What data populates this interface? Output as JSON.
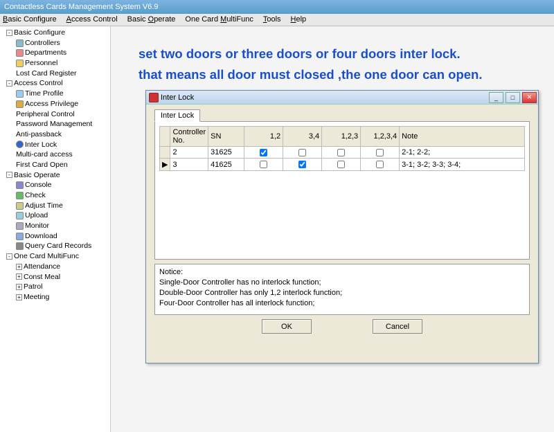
{
  "app_title": "Contactless Cards Management System  V6.9",
  "menu": [
    "Basic Configure",
    "Access Control",
    "Basic Operate",
    "One Card MultiFunc",
    "Tools",
    "Help"
  ],
  "tree": {
    "basic_configure": "Basic Configure",
    "controllers": "Controllers",
    "departments": "Departments",
    "personnel": "Personnel",
    "lost_card": "Lost Card Register",
    "access_control": "Access Control",
    "time_profile": "Time Profile",
    "access_priv": "Access Privilege",
    "periph": "Peripheral Control",
    "password": "Password Management",
    "antipass": "Anti-passback",
    "inter_lock": "Inter Lock",
    "multicard": "Multi-card access",
    "first_card": "First Card Open",
    "basic_operate": "Basic Operate",
    "console": "Console",
    "check": "Check",
    "adjust": "Adjust Time",
    "upload": "Upload",
    "monitor": "Monitor",
    "download": "Download",
    "query": "Query Card Records",
    "multifunc": "One Card MultiFunc",
    "attendance": "Attendance",
    "const_meal": "Const Meal",
    "patrol": "Patrol",
    "meeting": "Meeting"
  },
  "annotation": {
    "line1": "set two doors or three doors or four doors inter lock.",
    "line2": "that means all door must closed ,the one door can open."
  },
  "dialog": {
    "title": "Inter Lock",
    "tab": "Inter Lock",
    "headers": {
      "ctrl": "Controller No.",
      "sn": "SN",
      "c12": "1,2",
      "c34": "3,4",
      "c123": "1,2,3",
      "c1234": "1,2,3,4",
      "note": "Note"
    },
    "rows": [
      {
        "ctrl": "2",
        "sn": "31625",
        "c12": true,
        "c34": false,
        "c123": false,
        "c1234": false,
        "note": "2-1;  2-2;"
      },
      {
        "ctrl": "3",
        "sn": "41625",
        "c12": false,
        "c34": true,
        "c123": false,
        "c1234": false,
        "note": "3-1;  3-2;  3-3;  3-4;"
      }
    ],
    "notice": {
      "title": "Notice:",
      "l1": "Single-Door Controller has no interlock function;",
      "l2": "Double-Door Controller has only 1,2 interlock function;",
      "l3": "Four-Door Controller has all interlock function;"
    },
    "ok": "OK",
    "cancel": "Cancel"
  }
}
